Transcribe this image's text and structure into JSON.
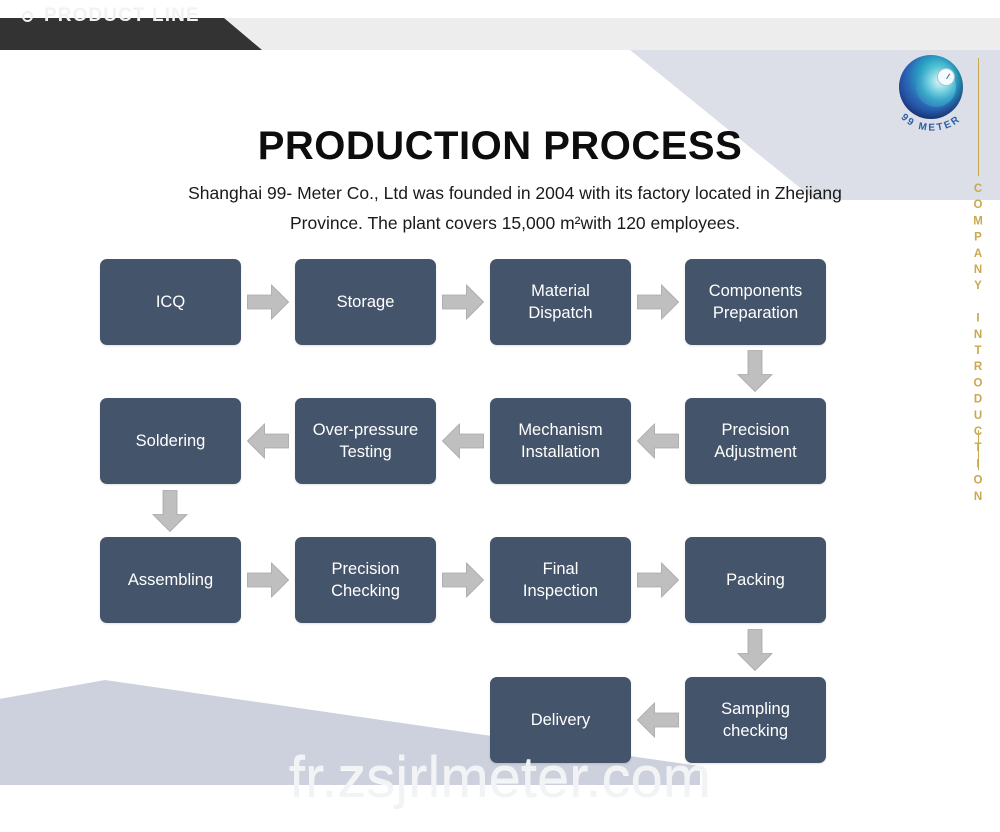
{
  "header": {
    "tab_label": "PRODUCT LINE",
    "bullet_icon": "circle-icon"
  },
  "brand": {
    "logo_icon": "99meter-swirl-logo",
    "logo_text": "99 METER",
    "vertical_label": "COMPANY INTRODUCTION",
    "accent_gold": "#c9a84f"
  },
  "content": {
    "title": "PRODUCTION PROCESS",
    "intro": "Shanghai 99- Meter Co., Ltd was founded in 2004 with its factory located in Zhejiang Province. The plant covers 15,000 m²with 120 employees."
  },
  "colors": {
    "box_fill": "#44546a",
    "arrow_fill": "#bfbfbf",
    "header_dark": "#333333",
    "header_strip": "#ededed",
    "wedge": "#ccd1dd"
  },
  "flow": {
    "box_color": "#44546a",
    "steps": [
      {
        "id": "icq",
        "label": "ICQ",
        "row": 1
      },
      {
        "id": "storage",
        "label": "Storage",
        "row": 1
      },
      {
        "id": "material-dispatch",
        "label": "Material\nDispatch",
        "row": 1
      },
      {
        "id": "components-preparation",
        "label": "Components\nPreparation",
        "row": 1
      },
      {
        "id": "soldering",
        "label": "Soldering",
        "row": 2
      },
      {
        "id": "over-pressure-testing",
        "label": "Over-pressure\nTesting",
        "row": 2
      },
      {
        "id": "mechanism-installation",
        "label": "Mechanism\nInstallation",
        "row": 2
      },
      {
        "id": "precision-adjustment",
        "label": "Precision\nAdjustment",
        "row": 2
      },
      {
        "id": "assembling",
        "label": "Assembling",
        "row": 3
      },
      {
        "id": "precision-checking",
        "label": "Precision\nChecking",
        "row": 3
      },
      {
        "id": "final-inspection",
        "label": "Final\nInspection",
        "row": 3
      },
      {
        "id": "packing",
        "label": "Packing",
        "row": 3
      },
      {
        "id": "delivery",
        "label": "Delivery",
        "row": 4
      },
      {
        "id": "sampling-checking",
        "label": "Sampling\nchecking",
        "row": 4
      }
    ],
    "connectors": [
      {
        "id": "icq-to-storage",
        "direction": "right"
      },
      {
        "id": "storage-to-material-dispatch",
        "direction": "right"
      },
      {
        "id": "material-dispatch-to-components-preparation",
        "direction": "right"
      },
      {
        "id": "components-preparation-to-precision-adjustment",
        "direction": "down"
      },
      {
        "id": "precision-adjustment-to-mechanism-installation",
        "direction": "left"
      },
      {
        "id": "mechanism-installation-to-over-pressure-testing",
        "direction": "left"
      },
      {
        "id": "over-pressure-testing-to-soldering",
        "direction": "left"
      },
      {
        "id": "soldering-to-assembling",
        "direction": "down"
      },
      {
        "id": "assembling-to-precision-checking",
        "direction": "right"
      },
      {
        "id": "precision-checking-to-final-inspection",
        "direction": "right"
      },
      {
        "id": "final-inspection-to-packing",
        "direction": "right"
      },
      {
        "id": "packing-to-sampling-checking",
        "direction": "down"
      },
      {
        "id": "sampling-checking-to-delivery",
        "direction": "left"
      }
    ]
  },
  "watermark": {
    "text": "fr.zsjrlmeter.com"
  }
}
